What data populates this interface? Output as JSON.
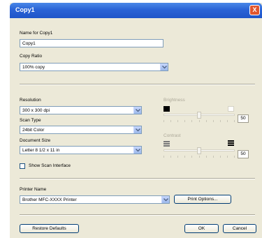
{
  "window": {
    "title": "Copy1",
    "close_glyph": "X"
  },
  "name_field": {
    "label": "Name for Copy1",
    "value": "Copy1"
  },
  "copy_ratio": {
    "label": "Copy Ratio",
    "value": "100% copy"
  },
  "resolution": {
    "label": "Resolution",
    "value": "300 x 300 dpi"
  },
  "scan_type": {
    "label": "Scan Type",
    "value": "24bit Color"
  },
  "document_size": {
    "label": "Document Size",
    "value": "Letter 8 1/2 x 11 in"
  },
  "show_scan_interface": {
    "label": "Show Scan Interface",
    "checked": false
  },
  "brightness": {
    "label": "Brightness",
    "value": "50",
    "level": 0.5
  },
  "contrast": {
    "label": "Contrast",
    "value": "50",
    "level": 0.5
  },
  "printer": {
    "label": "Printer Name",
    "value": "Brother MFC-XXXX  Printer",
    "options_label": "Print Options..."
  },
  "footer": {
    "restore_label": "Restore Defaults",
    "ok_label": "OK",
    "cancel_label": "Cancel"
  },
  "colors": {
    "titlebar": "#2a63d6",
    "dialog_bg": "#ece9d8",
    "disabled_text": "#aca899"
  }
}
